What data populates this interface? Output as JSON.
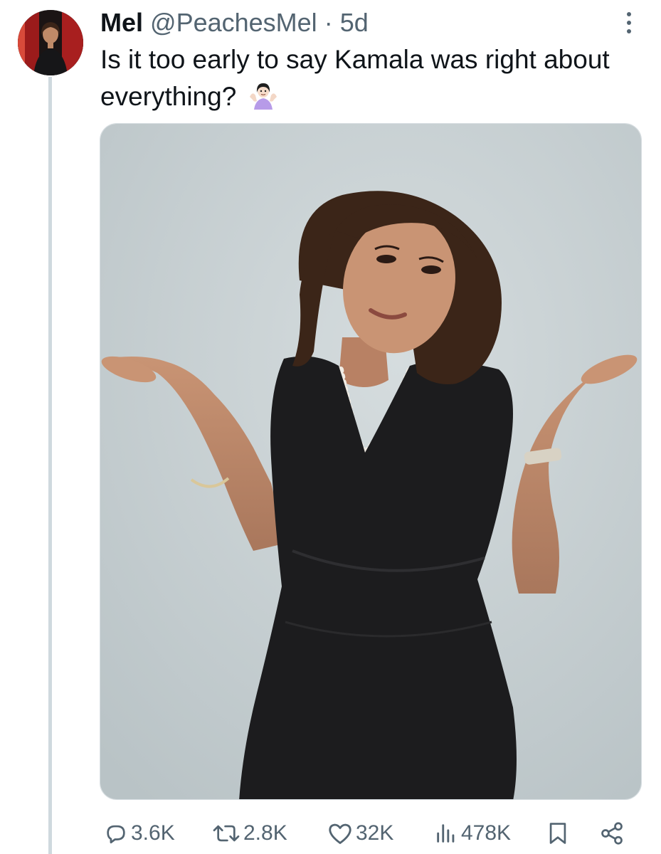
{
  "tweet": {
    "author_name": "Mel",
    "author_handle": "@PeachesMel",
    "separator": "·",
    "time": "5d",
    "text": "Is it too early to say Kamala was right about everything?",
    "emoji": "shrugging-woman-emoji"
  },
  "icons": {
    "more": "more-options-icon",
    "reply": "reply-icon",
    "retweet": "retweet-icon",
    "like": "like-icon",
    "views": "views-icon",
    "bookmark": "bookmark-icon",
    "share": "share-icon"
  },
  "actions": {
    "replies": "3.6K",
    "retweets": "2.8K",
    "likes": "32K",
    "views": "478K"
  },
  "colors": {
    "text": "#0f1419",
    "secondary": "#536471",
    "thread_line": "#cfd9de",
    "photo_background": "#c9d1d3",
    "dress": "#1c1c1e"
  }
}
